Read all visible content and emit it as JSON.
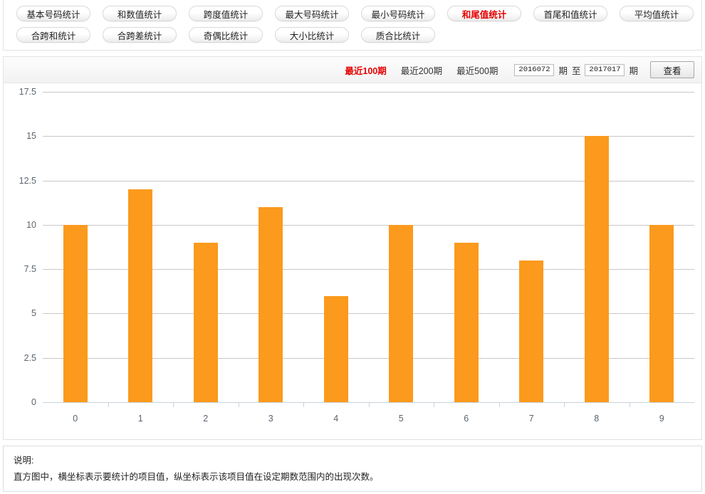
{
  "tabs": {
    "row1": [
      {
        "label": "基本号码统计",
        "active": false
      },
      {
        "label": "和数值统计",
        "active": false
      },
      {
        "label": "跨度值统计",
        "active": false
      },
      {
        "label": "最大号码统计",
        "active": false
      },
      {
        "label": "最小号码统计",
        "active": false
      },
      {
        "label": "和尾值统计",
        "active": true
      },
      {
        "label": "首尾和值统计",
        "active": false
      },
      {
        "label": "平均值统计",
        "active": false
      }
    ],
    "row2": [
      {
        "label": "合跨和统计",
        "active": false
      },
      {
        "label": "合跨差统计",
        "active": false
      },
      {
        "label": "奇偶比统计",
        "active": false
      },
      {
        "label": "大小比统计",
        "active": false
      },
      {
        "label": "质合比统计",
        "active": false
      }
    ]
  },
  "toolbar": {
    "ranges": [
      {
        "label": "最近100期",
        "active": true
      },
      {
        "label": "最近200期",
        "active": false
      },
      {
        "label": "最近500期",
        "active": false
      }
    ],
    "period_from_value": "2016072",
    "period_to_value": "2017017",
    "unit_from": "期",
    "separator": "至",
    "unit_to": "期",
    "view_button_label": "查看"
  },
  "chart_data": {
    "type": "bar",
    "title": "",
    "xlabel": "",
    "ylabel": "",
    "categories": [
      "0",
      "1",
      "2",
      "3",
      "4",
      "5",
      "6",
      "7",
      "8",
      "9"
    ],
    "values": [
      10,
      12,
      9,
      11,
      6,
      10,
      9,
      8,
      15,
      10
    ],
    "ylim": [
      0,
      17.5
    ],
    "yticks": [
      "0",
      "2.5",
      "5",
      "7.5",
      "10",
      "12.5",
      "15",
      "17.5"
    ],
    "ytick_values": [
      0,
      2.5,
      5,
      7.5,
      10,
      12.5,
      15,
      17.5
    ],
    "grid": true,
    "legend": null,
    "bar_color": "#fb9a1c"
  },
  "note": {
    "title": "说明:",
    "body": "直方图中，横坐标表示要统计的项目值，纵坐标表示该项目值在设定期数范围内的出现次数。"
  }
}
